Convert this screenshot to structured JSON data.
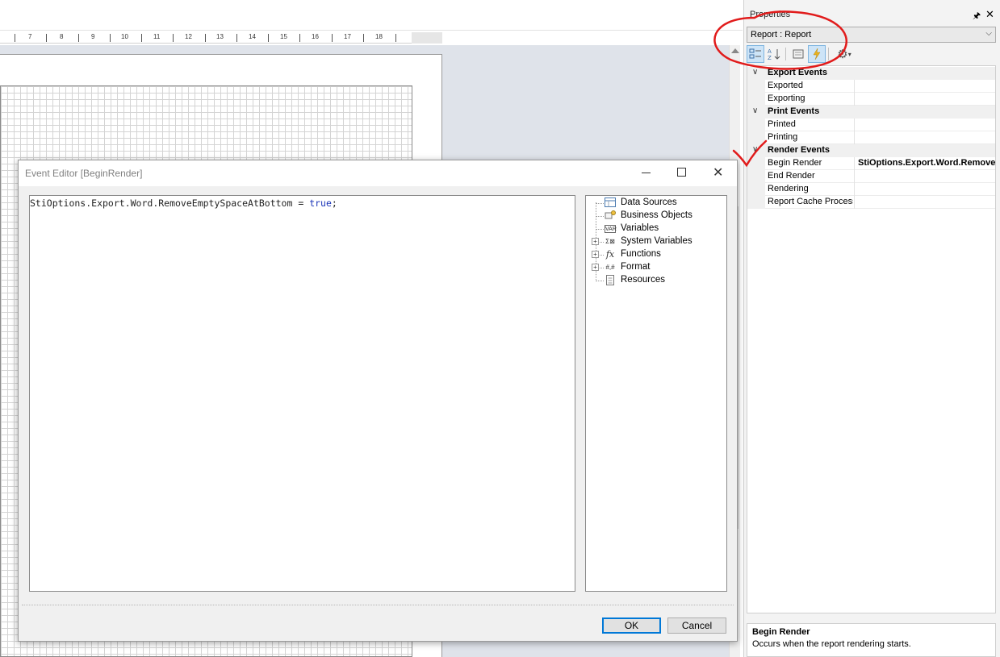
{
  "ruler": {
    "numbers": [
      "7",
      "8",
      "9",
      "10",
      "11",
      "12",
      "13",
      "14",
      "15",
      "16",
      "17",
      "18"
    ]
  },
  "properties": {
    "title": "Properties",
    "object_selector": "Report : Report",
    "categories": [
      {
        "label": "Export  Events",
        "items": [
          {
            "name": "Exported",
            "value": ""
          },
          {
            "name": "Exporting",
            "value": ""
          }
        ]
      },
      {
        "label": "Print  Events",
        "items": [
          {
            "name": "Printed",
            "value": ""
          },
          {
            "name": "Printing",
            "value": ""
          }
        ]
      },
      {
        "label": "Render  Events",
        "items": [
          {
            "name": "Begin Render",
            "value": "StiOptions.Export.Word.RemoveEmptySpaceAtBottom = true;"
          },
          {
            "name": "End Render",
            "value": ""
          },
          {
            "name": "Rendering",
            "value": ""
          },
          {
            "name": "Report Cache Processing",
            "value": ""
          }
        ]
      }
    ],
    "description": {
      "title": "Begin Render",
      "text": "Occurs when the report rendering starts."
    }
  },
  "dialog": {
    "title": "Event Editor [BeginRender]",
    "code": {
      "prefix": "StiOptions.Export.Word.RemoveEmptySpaceAtBottom = ",
      "keyword": "true",
      "suffix": ";"
    },
    "tree": [
      {
        "label": "Data Sources",
        "icon": "table-icon",
        "expandable": false
      },
      {
        "label": "Business Objects",
        "icon": "business-objects-icon",
        "expandable": false
      },
      {
        "label": "Variables",
        "icon": "variable-icon",
        "expandable": false
      },
      {
        "label": "System Variables",
        "icon": "system-variables-icon",
        "expandable": true
      },
      {
        "label": "Functions",
        "icon": "function-icon",
        "expandable": true
      },
      {
        "label": "Format",
        "icon": "format-icon",
        "expandable": true
      },
      {
        "label": "Resources",
        "icon": "resources-icon",
        "expandable": false
      }
    ],
    "buttons": {
      "ok": "OK",
      "cancel": "Cancel"
    }
  },
  "colors": {
    "annotation": "#e11b1b",
    "accent": "#0078d7",
    "keyword": "#1a34b8"
  }
}
